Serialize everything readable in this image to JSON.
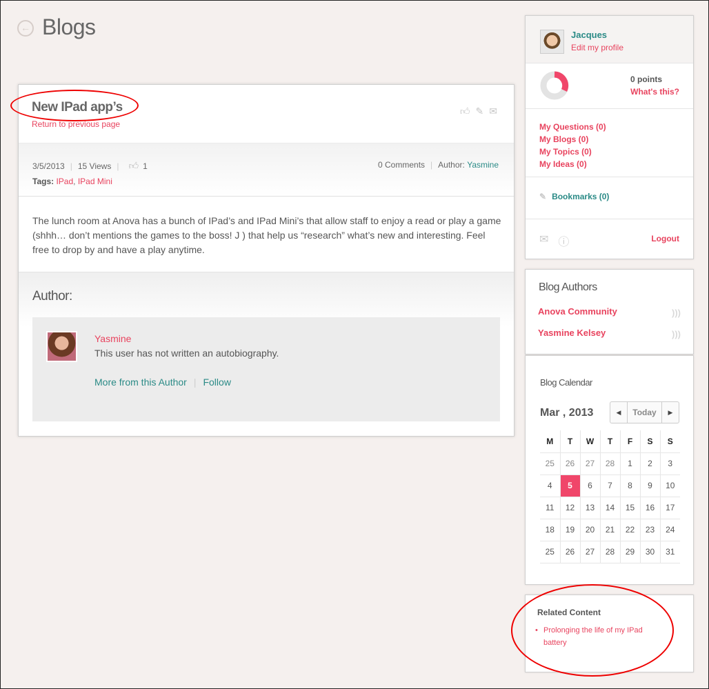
{
  "header": {
    "title": "Blogs",
    "back_icon": "arrow-left-circle-icon"
  },
  "post": {
    "title": "New IPad app’s",
    "return_link": "Return to previous page",
    "action_icons": [
      "thumbs-up-icon",
      "bookmark-icon",
      "envelope-icon"
    ],
    "date": "3/5/2013",
    "views": "15 Views",
    "likes": "1",
    "comments": "0 Comments",
    "author_label": "Author:",
    "author": "Yasmine",
    "tags_label": "Tags:",
    "tags": [
      "IPad",
      "IPad Mini"
    ],
    "tag_separator": ",",
    "body": "The lunch room at Anova has a bunch of IPad’s and IPad Mini’s that allow staff to enjoy a read or play a game (shhh… don’t mentions the games to the boss! J ) that help us “research” what’s new and interesting. Feel free to drop by and have a play anytime."
  },
  "author_section": {
    "heading": "Author:",
    "name": "Yasmine",
    "bio": "This user has not written an autobiography.",
    "more_link": "More from this Author",
    "follow_link": "Follow"
  },
  "profile": {
    "name": "Jacques",
    "edit_link": "Edit my profile",
    "points": "0 points",
    "points_help": "What's this?",
    "links": [
      "My Questions (0)",
      "My Blogs (0)",
      "My Topics (0)",
      "My Ideas (0)"
    ],
    "bookmarks": "Bookmarks (0)",
    "logout": "Logout"
  },
  "blog_authors": {
    "title": "Blog Authors",
    "items": [
      "Anova Community",
      "Yasmine Kelsey"
    ]
  },
  "calendar": {
    "title": "Blog Calendar",
    "month": "Mar , 2013",
    "today_label": "Today",
    "weekdays": [
      "M",
      "T",
      "W",
      "T",
      "F",
      "S",
      "S"
    ],
    "weeks": [
      [
        "25",
        "26",
        "27",
        "28",
        "1",
        "2",
        "3"
      ],
      [
        "4",
        "5",
        "6",
        "7",
        "8",
        "9",
        "10"
      ],
      [
        "11",
        "12",
        "13",
        "14",
        "15",
        "16",
        "17"
      ],
      [
        "18",
        "19",
        "20",
        "21",
        "22",
        "23",
        "24"
      ],
      [
        "25",
        "26",
        "27",
        "28",
        "29",
        "30",
        "31"
      ]
    ],
    "selected_day": "5"
  },
  "related": {
    "title": "Related Content",
    "items": [
      "Prolonging the life of my IPad battery"
    ]
  },
  "colors": {
    "accent": "#e8435e",
    "teal": "#2a8a86",
    "today": "#f0466a",
    "annotation": "#e00000"
  }
}
